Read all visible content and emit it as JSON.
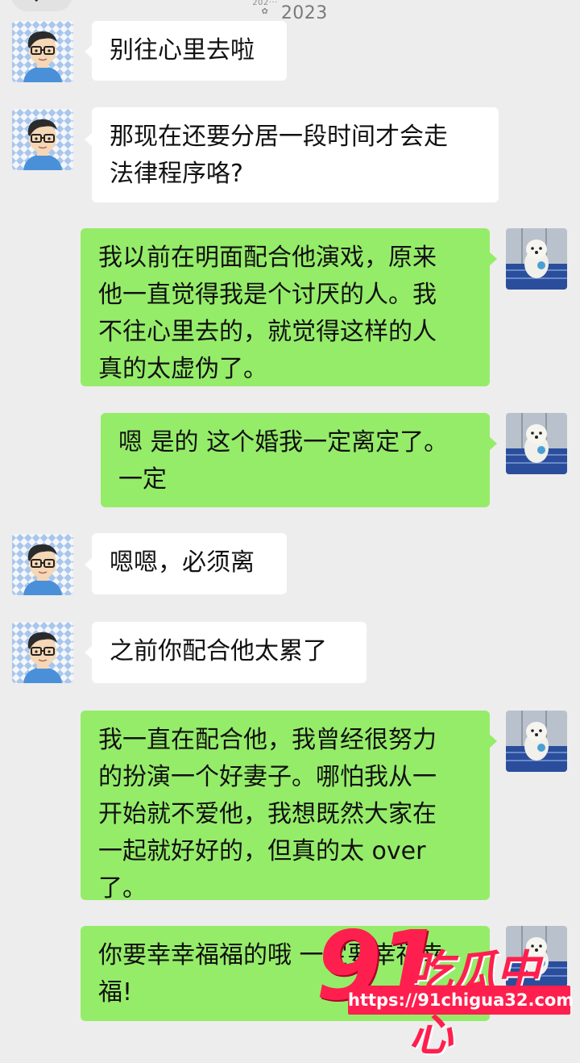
{
  "header": {
    "title": "2023",
    "icon": "group-icon"
  },
  "colors": {
    "background": "#ededed",
    "incoming_bubble": "#ffffff",
    "outgoing_bubble": "#95ec69",
    "watermark": "#ff1f4e"
  },
  "messages": [
    {
      "side": "in",
      "text": "别往心里去啦"
    },
    {
      "side": "in",
      "text": "那现在还要分居一段时间才会走\n法律程序咯?"
    },
    {
      "side": "out",
      "text": "我以前在明面配合他演戏，原来\n他一直觉得我是个讨厌的人。我\n不往心里去的，就觉得这样的人\n真的太虚伪了。"
    },
    {
      "side": "out",
      "text": "嗯 是的 这个婚我一定离定了。\n一定"
    },
    {
      "side": "in",
      "text": "嗯嗯，必须离"
    },
    {
      "side": "in",
      "text": "之前你配合他太累了"
    },
    {
      "side": "out",
      "text": "我一直在配合他，我曾经很努力\n的扮演一个好妻子。哪怕我从一\n开始就不爱他，我想既然大家在\n一起就好好的，但真的太 over\n了。"
    },
    {
      "side": "out",
      "text": "你要幸幸福福的哦 一定要幸福幸\n福!"
    }
  ],
  "watermark": {
    "number": "91",
    "text": "吃瓜中心",
    "url": "https://91chigua32.com"
  }
}
